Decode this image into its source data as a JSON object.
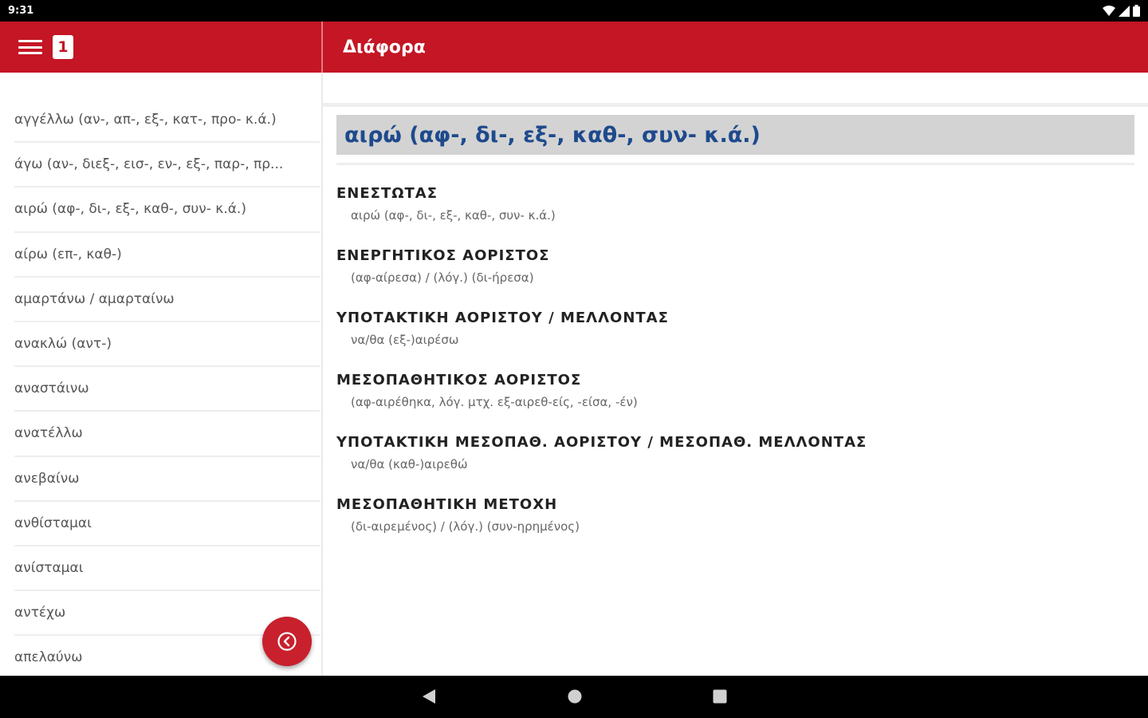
{
  "status": {
    "time": "9:31",
    "icons": [
      "wifi-icon",
      "signal-icon",
      "battery-icon"
    ]
  },
  "appbar": {
    "menu_icon": "hamburger-menu-icon",
    "badge": "1",
    "title": "Διάφορα"
  },
  "verbs": [
    "αγγέλλω (αν-, απ-, εξ-, κατ-, προ- κ.ά.)",
    "άγω (αν-, διεξ-, εισ-, εν-, εξ-, παρ-, πρ...",
    "αιρώ (αφ-, δι-, εξ-, καθ-, συν- κ.ά.)",
    "αίρω (επ-, καθ-)",
    "αμαρτάνω / αμαρταίνω",
    "ανακλώ (αντ-)",
    "αναστάινω",
    "ανατέλλω",
    "ανεβαίνω",
    "ανθίσταμαι",
    "ανίσταμαι",
    "αντέχω",
    "απελαύνω"
  ],
  "fab": {
    "icon": "chevron-left-circle-icon"
  },
  "detail": {
    "header": "αιρώ (αφ-, δι-, εξ-, καθ-, συν- κ.ά.)",
    "sections": [
      {
        "title": "ΕΝΕΣΤΩΤΑΣ",
        "value": "αιρώ (αφ-, δι-, εξ-, καθ-, συν- κ.ά.)"
      },
      {
        "title": "ΕΝΕΡΓΗΤΙΚΟΣ ΑΟΡΙΣΤΟΣ",
        "value": "(αφ-αίρεσα) / (λόγ.) (δι-ήρεσα)"
      },
      {
        "title": "ΥΠΟΤΑΚΤΙΚΗ ΑΟΡΙΣΤΟΥ / ΜΕΛΛΟΝΤΑΣ",
        "value": "να/θα (εξ-)αιρέσω"
      },
      {
        "title": "ΜΕΣΟΠΑΘΗΤΙΚΟΣ ΑΟΡΙΣΤΟΣ",
        "value": "(αφ-αιρέθηκα, λόγ. μτχ. εξ-αιρεθ-είς, -είσα, -έν)"
      },
      {
        "title": "ΥΠΟΤΑΚΤΙΚΗ ΜΕΣΟΠΑΘ. ΑΟΡΙΣΤΟΥ / ΜΕΣΟΠΑΘ. ΜΕΛΛΟΝΤΑΣ",
        "value": "να/θα (καθ-)αιρεθώ"
      },
      {
        "title": "ΜΕΣΟΠΑΘΗΤΙΚΗ ΜΕΤΟΧΗ",
        "value": "(δι-αιρεμένος) / (λόγ.) (συν-ηρημένος)"
      }
    ]
  },
  "nav": {
    "back_icon": "back-triangle-icon",
    "home_icon": "home-circle-icon",
    "recents_icon": "recents-square-icon"
  },
  "colors": {
    "brand_red": "#c41624",
    "header_blue": "#1e4a8c",
    "header_bg": "#d3d3d3"
  }
}
